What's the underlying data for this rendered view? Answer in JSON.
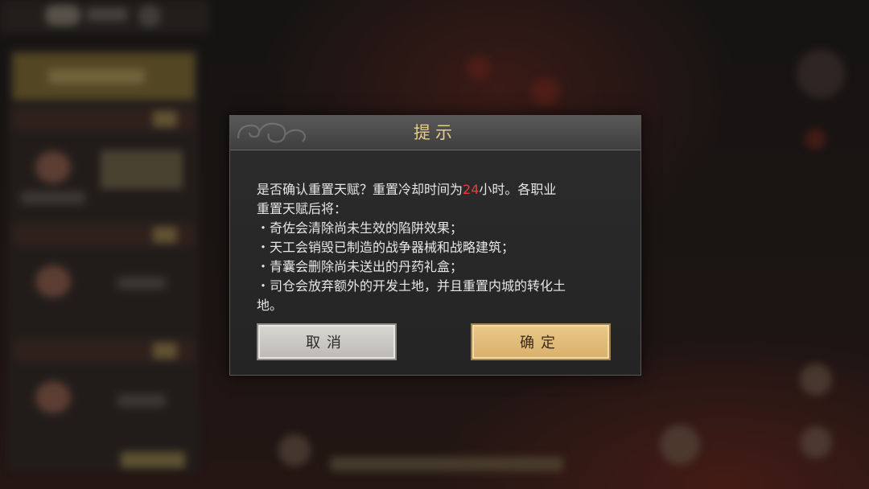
{
  "dialog": {
    "title": "提示",
    "message": {
      "line1_before": "是否确认重置天赋？重置冷却时间为",
      "hours": "24",
      "line1_after": "小时。各职业",
      "line2": "重置天赋后将：",
      "bullets": [
        "・奇佐会清除尚未生效的陷阱效果；",
        "・天工会销毁已制造的战争器械和战略建筑；",
        "・青囊会删除尚未送出的丹药礼盒；",
        "・司仓会放弃额外的开发土地，并且重置内城的转化土"
      ],
      "last_line": "地。"
    },
    "cancel_label": "取消",
    "confirm_label": "确定"
  },
  "colors": {
    "title": "#e8cc8a",
    "highlight": "#e0413a",
    "confirm_bg": "#d9b06b",
    "cancel_bg": "#c8c5bf"
  }
}
